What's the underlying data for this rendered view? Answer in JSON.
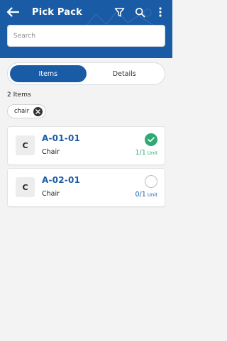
{
  "colors": {
    "primary": "#1a5ba6",
    "success": "#2eaa72",
    "background": "#f3f3f3"
  },
  "header": {
    "title": "Pick Pack",
    "icons": [
      "back-arrow-icon",
      "filter-icon",
      "search-icon",
      "more-vert-icon"
    ]
  },
  "search": {
    "placeholder": "Search",
    "value": ""
  },
  "tabs": [
    {
      "label": "Items",
      "active": true
    },
    {
      "label": "Details",
      "active": false
    }
  ],
  "items_count": "2 Items",
  "filter_chip": {
    "label": "chair"
  },
  "items": [
    {
      "avatar": "C",
      "location": "A-01-01",
      "name": "Chair",
      "qty": "1/1",
      "unit": "Unit",
      "completed": true
    },
    {
      "avatar": "C",
      "location": "A-02-01",
      "name": "Chair",
      "qty": "0/1",
      "unit": "Unit",
      "completed": false
    }
  ]
}
